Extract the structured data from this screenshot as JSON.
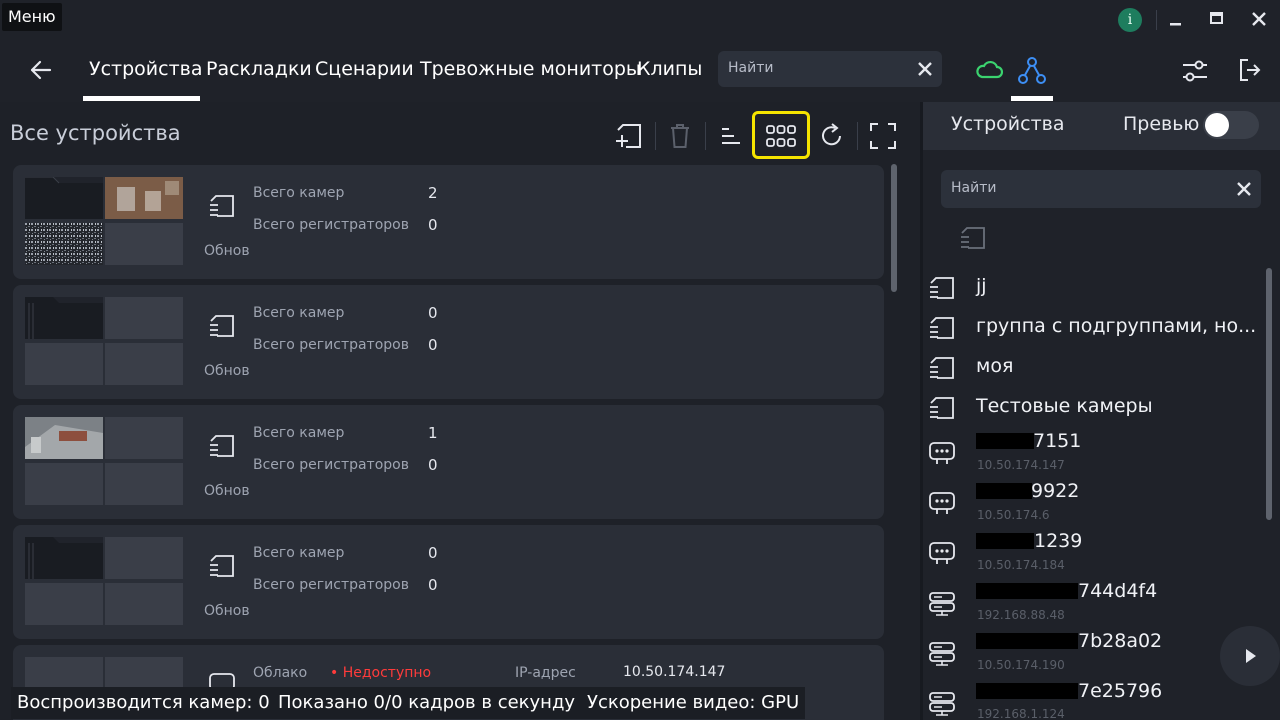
{
  "menu": {
    "label": "Меню"
  },
  "window": {
    "info": "i"
  },
  "nav": {
    "tabs": [
      {
        "label": "Устройства"
      },
      {
        "label": "Раскладки"
      },
      {
        "label": "Сценарии"
      },
      {
        "label": "Тревожные мониторы"
      },
      {
        "label": "Клипы"
      }
    ],
    "search_placeholder": "Найти"
  },
  "main": {
    "title": "Все устройства",
    "cards": [
      {
        "label1": "Всего камер",
        "value1": "2",
        "label2": "Всего регистраторов",
        "value2": "0",
        "footer": "Обнов"
      },
      {
        "label1": "Всего камер",
        "value1": "0",
        "label2": "Всего регистраторов",
        "value2": "0",
        "footer": "Обнов"
      },
      {
        "label1": "Всего камер",
        "value1": "1",
        "label2": "Всего регистраторов",
        "value2": "0",
        "footer": "Обнов"
      },
      {
        "label1": "Всего камер",
        "value1": "0",
        "label2": "Всего регистраторов",
        "value2": "0",
        "footer": "Обнов"
      },
      {
        "label1": "Облако",
        "status": "• Недоступно",
        "label2": "IP-адрес",
        "value2": "10.50.174.147"
      }
    ]
  },
  "right": {
    "title": "Устройства",
    "preview_label": "Превью",
    "search_placeholder": "Найти",
    "groups": [
      {
        "name": "jj"
      },
      {
        "name": "группа с подгруппами, но..."
      },
      {
        "name": "моя"
      },
      {
        "name": "Тестовые камеры"
      }
    ],
    "devices": [
      {
        "name": "7151",
        "ip": "10.50.174.147"
      },
      {
        "name": "9922",
        "ip": "10.50.174.6"
      },
      {
        "name": "1239",
        "ip": "10.50.174.184"
      },
      {
        "name": "744d4f4",
        "ip": "192.168.88.48"
      },
      {
        "name": "7b28a02",
        "ip": "10.50.174.190"
      },
      {
        "name": "7e25796",
        "ip": "192.168.1.124"
      }
    ]
  },
  "status": {
    "cameras": "Воспроизводится камер: 0",
    "fps": "Показано 0/0 кадров в секунду",
    "accel": "Ускорение видео: GPU"
  },
  "colors": {
    "accent_highlight": "#f5e400",
    "cloud_green": "#3bd36f",
    "network_blue": "#3d8ff5",
    "unavailable_red": "#ff3b3b"
  }
}
